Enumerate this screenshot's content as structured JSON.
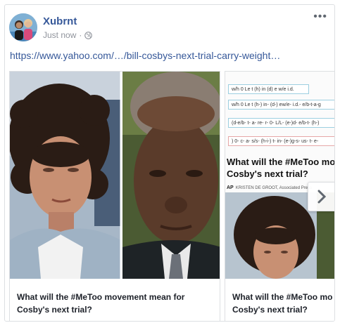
{
  "post": {
    "author": "Xubrnt",
    "timestamp": "Just now",
    "separator": "·",
    "privacy_icon": "globe-icon",
    "more_icon": "more-options-icon",
    "link_url": "https://www.yahoo.com/…/bill-cosbys-next-trial-carry-weight…"
  },
  "carousel": {
    "items": [
      {
        "caption": "What will the #MeToo movement mean for Cosby's next trial?"
      },
      {
        "caption": "What will the #MeToo mo Cosby's next trial?",
        "doc_lines": [
          "w/h 0 Le t (h) in (d) e w/e i.d.",
          "w/h 0 Le t (h-) in- (d-) ew/e- i.d.- e/b-t-a-g",
          "(d-e/b- t- a- re- r- 0- L/L- (e-)d- e/b-t- (h-)",
          ") 0- c- a- s/s- (h-i-) t- in- (e-)g-s- us- t- e-"
        ],
        "doc_headline": "What will the #MeToo mo Cosby's next trial?",
        "doc_byline_source": "AP",
        "doc_byline_author": "KRISTEN DE GROOT, Associated Press"
      }
    ],
    "next_icon": "chevron-right-icon"
  },
  "colors": {
    "link": "#365899",
    "meta": "#90949c",
    "border": "#dddfe2",
    "text": "#1d2129"
  }
}
